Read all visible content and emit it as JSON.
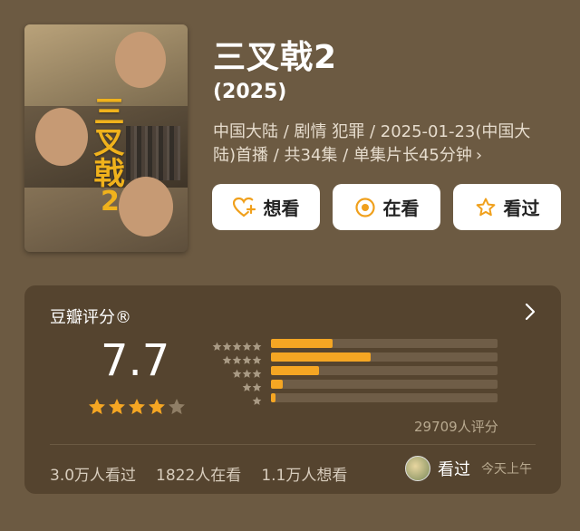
{
  "show": {
    "title": "三叉戟2",
    "year": "(2025)",
    "meta_line": "中国大陆 / 剧情 犯罪 / 2025-01-23(中国大陆)首播 / 共34集 / 单集片长45分钟",
    "meta_chevron": "›",
    "poster": {
      "title_vertical": "三叉戟",
      "title_number": "2"
    }
  },
  "actions": [
    {
      "label": "想看",
      "icon": "heart-plus-icon"
    },
    {
      "label": "在看",
      "icon": "target-icon"
    },
    {
      "label": "看过",
      "icon": "star-outline-icon"
    }
  ],
  "rating": {
    "label": "豆瓣评分®",
    "score": "7.7",
    "stars_filled": 4,
    "stars_total": 5,
    "distribution": [
      {
        "stars": 5,
        "fraction": 0.27
      },
      {
        "stars": 4,
        "fraction": 0.44
      },
      {
        "stars": 3,
        "fraction": 0.21
      },
      {
        "stars": 2,
        "fraction": 0.05
      },
      {
        "stars": 1,
        "fraction": 0.02
      }
    ],
    "count_text": "29709人评分"
  },
  "stats": {
    "watched": "3.0万人看过",
    "watching": "1822人在看",
    "want": "1.1万人想看"
  },
  "friend": {
    "action": "看过",
    "time": "今天上午"
  },
  "colors": {
    "background": "#6c5a42",
    "card": "#55442f",
    "accent": "#f5a623",
    "action_icon": "#f0a01c"
  }
}
